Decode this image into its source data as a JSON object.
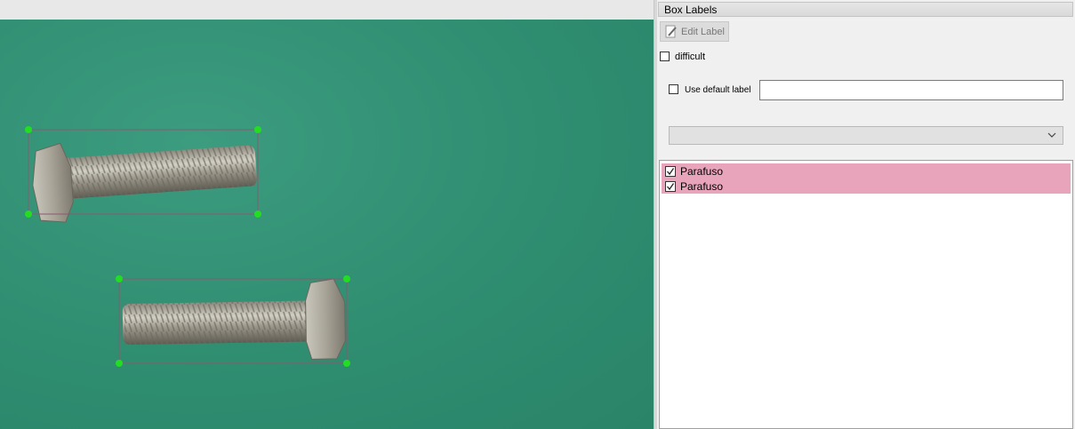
{
  "dock": {
    "title": "Box Labels",
    "edit_label_button": "Edit Label",
    "difficult_label": "difficult",
    "use_default_label": "Use default label",
    "default_label_value": "",
    "combo_value": ""
  },
  "labels": [
    {
      "text": "Parafuso",
      "checked": true
    },
    {
      "text": "Parafuso",
      "checked": true
    }
  ],
  "colors": {
    "canvas_background": "#2f8d70",
    "box_outline": "#8a5a70",
    "handle": "#22dd22",
    "label_row_highlight": "#e7a4bb"
  }
}
